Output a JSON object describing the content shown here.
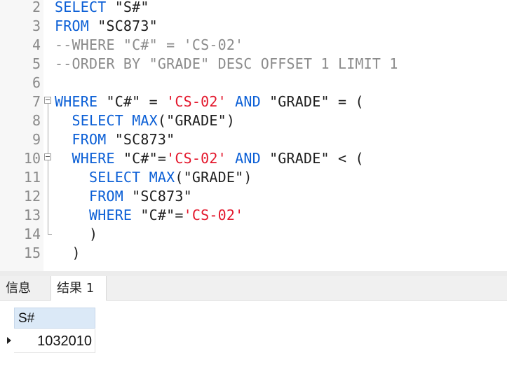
{
  "editor": {
    "lines": [
      {
        "no": "2",
        "tokens": [
          {
            "t": "SELECT",
            "c": "kw"
          },
          {
            "t": " \"S#\"",
            "c": "id"
          }
        ]
      },
      {
        "no": "3",
        "tokens": [
          {
            "t": "FROM",
            "c": "kw"
          },
          {
            "t": " \"SC873\"",
            "c": "id"
          }
        ]
      },
      {
        "no": "4",
        "tokens": [
          {
            "t": "--WHERE \"C#\" = 'CS-02'",
            "c": "cm"
          }
        ]
      },
      {
        "no": "5",
        "tokens": [
          {
            "t": "--ORDER BY \"GRADE\" DESC OFFSET 1 LIMIT 1",
            "c": "cm"
          }
        ]
      },
      {
        "no": "6",
        "tokens": []
      },
      {
        "no": "7",
        "tokens": [
          {
            "t": "WHERE",
            "c": "kw"
          },
          {
            "t": " \"C#\" = ",
            "c": "id"
          },
          {
            "t": "'CS-02'",
            "c": "str"
          },
          {
            "t": " ",
            "c": "id"
          },
          {
            "t": "AND",
            "c": "kw"
          },
          {
            "t": " \"GRADE\" = (",
            "c": "id"
          }
        ]
      },
      {
        "no": "8",
        "tokens": [
          {
            "t": "  ",
            "c": "id"
          },
          {
            "t": "SELECT",
            "c": "kw"
          },
          {
            "t": " ",
            "c": "id"
          },
          {
            "t": "MAX",
            "c": "kw"
          },
          {
            "t": "(\"GRADE\")",
            "c": "id"
          }
        ]
      },
      {
        "no": "9",
        "tokens": [
          {
            "t": "  ",
            "c": "id"
          },
          {
            "t": "FROM",
            "c": "kw"
          },
          {
            "t": " \"SC873\"",
            "c": "id"
          }
        ]
      },
      {
        "no": "10",
        "tokens": [
          {
            "t": "  ",
            "c": "id"
          },
          {
            "t": "WHERE",
            "c": "kw"
          },
          {
            "t": " \"C#\"=",
            "c": "id"
          },
          {
            "t": "'CS-02'",
            "c": "str"
          },
          {
            "t": " ",
            "c": "id"
          },
          {
            "t": "AND",
            "c": "kw"
          },
          {
            "t": " \"GRADE\" < (",
            "c": "id"
          }
        ]
      },
      {
        "no": "11",
        "tokens": [
          {
            "t": "    ",
            "c": "id"
          },
          {
            "t": "SELECT",
            "c": "kw"
          },
          {
            "t": " ",
            "c": "id"
          },
          {
            "t": "MAX",
            "c": "kw"
          },
          {
            "t": "(\"GRADE\")",
            "c": "id"
          }
        ]
      },
      {
        "no": "12",
        "tokens": [
          {
            "t": "    ",
            "c": "id"
          },
          {
            "t": "FROM",
            "c": "kw"
          },
          {
            "t": " \"SC873\"",
            "c": "id"
          }
        ]
      },
      {
        "no": "13",
        "tokens": [
          {
            "t": "    ",
            "c": "id"
          },
          {
            "t": "WHERE",
            "c": "kw"
          },
          {
            "t": " \"C#\"=",
            "c": "id"
          },
          {
            "t": "'CS-02'",
            "c": "str"
          }
        ]
      },
      {
        "no": "14",
        "tokens": [
          {
            "t": "    )",
            "c": "id"
          }
        ]
      },
      {
        "no": "15",
        "tokens": [
          {
            "t": "  )",
            "c": "id"
          }
        ]
      }
    ]
  },
  "tabs": {
    "info": "信息",
    "result": "结果 1"
  },
  "result": {
    "columns": [
      "S#"
    ],
    "rows": [
      [
        "1032010"
      ]
    ]
  },
  "colors": {
    "keyword": "#0b5fd6",
    "string": "#e3172c",
    "comment": "#8c8c8c",
    "header_bg": "#dbe9f7"
  }
}
